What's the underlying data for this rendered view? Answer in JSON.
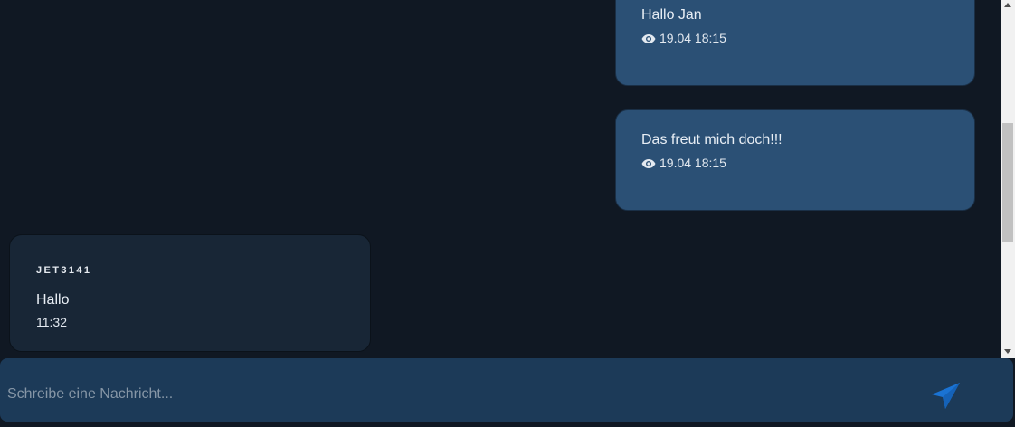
{
  "messages": [
    {
      "direction": "outgoing",
      "text": "Hallo Jan",
      "read_icon": "eye-icon",
      "timestamp": "19.04 18:15"
    },
    {
      "direction": "outgoing",
      "text": "Das freut mich doch!!!",
      "read_icon": "eye-icon",
      "timestamp": "19.04 18:15"
    },
    {
      "direction": "incoming",
      "sender": "JET3141",
      "text": "Hallo",
      "timestamp": "11:32"
    }
  ],
  "composer": {
    "placeholder": "Schreibe eine Nachricht...",
    "value": "",
    "send_icon": "send-icon"
  },
  "colors": {
    "background": "#101823",
    "outgoing_bubble": "#2b5075",
    "incoming_bubble": "#182636",
    "composer_background": "#1c3a58",
    "send_accent": "#1a73d4"
  }
}
